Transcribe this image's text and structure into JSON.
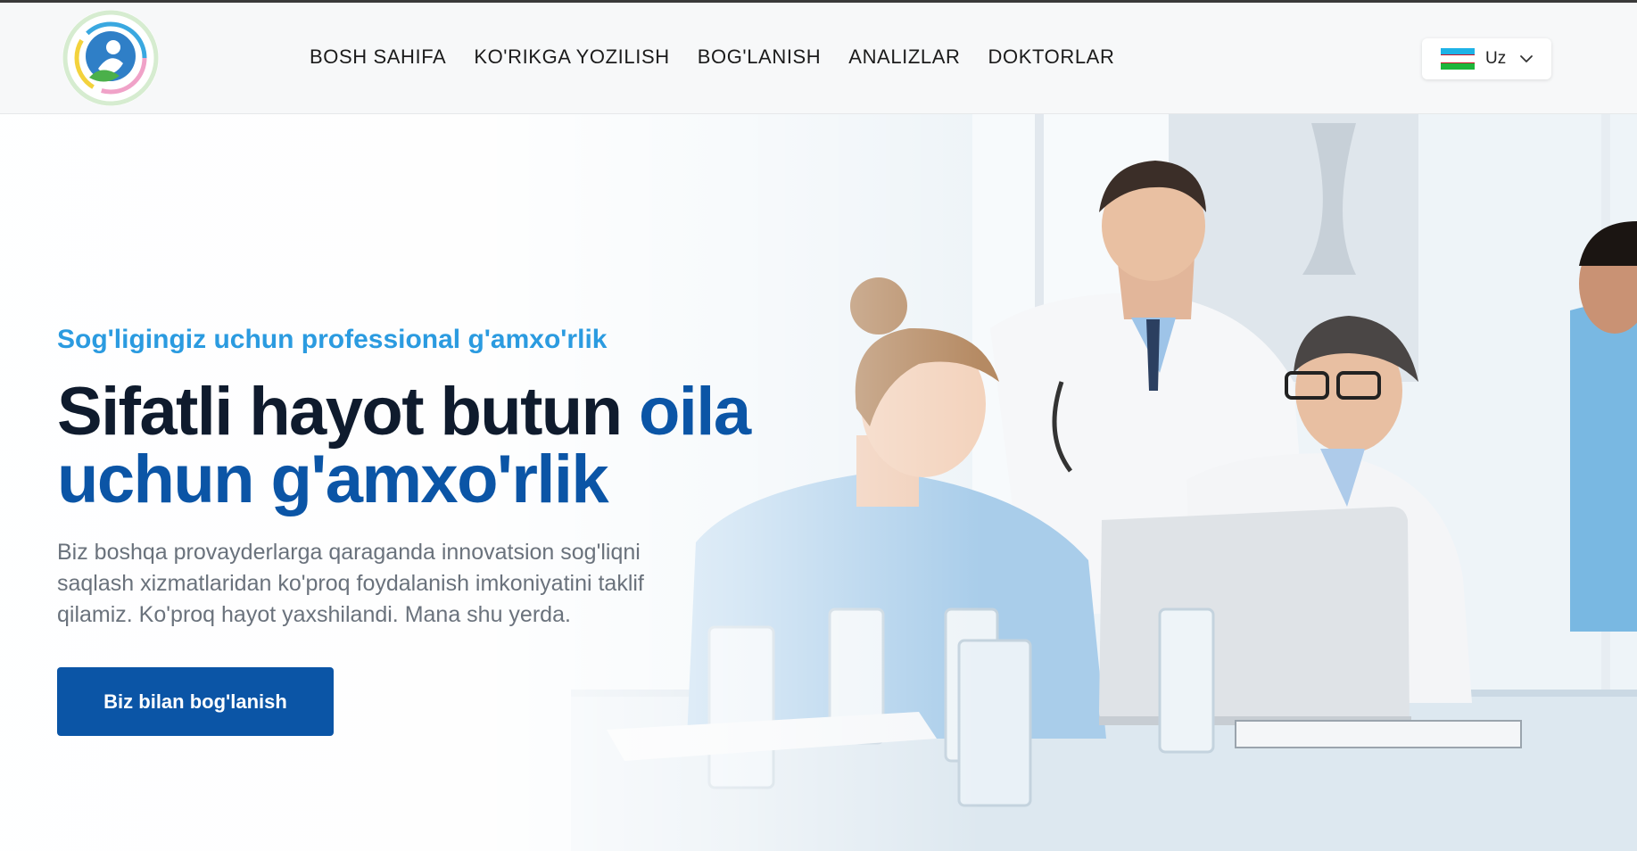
{
  "header": {
    "nav": [
      {
        "label": "BOSH SAHIFA"
      },
      {
        "label": "KO'RIKGA YOZILISH"
      },
      {
        "label": "BOG'LANISH"
      },
      {
        "label": "ANALIZLAR"
      },
      {
        "label": "DOKTORLAR"
      }
    ],
    "language": {
      "code": "Uz",
      "flag_icon": "uzbekistan-flag-icon"
    }
  },
  "hero": {
    "tagline": "Sog'ligingiz uchun professional g'amxo'rlik",
    "headline_part1": "Sifatli hayot butun ",
    "headline_accent": "oila uchun g'amxo'rlik",
    "description": "Biz boshqa provayderlarga qaraganda innovatsion sog'liqni saqlash xizmatlaridan ko'proq foydalanish imkoniyatini taklif qilamiz. Ko'proq hayot yaxshilandi. Mana shu yerda.",
    "cta_label": "Biz bilan bog'lanish"
  },
  "colors": {
    "brand_blue": "#0b55a6",
    "accent_light_blue": "#2b9be0",
    "heading_dark": "#0f1b2d"
  }
}
